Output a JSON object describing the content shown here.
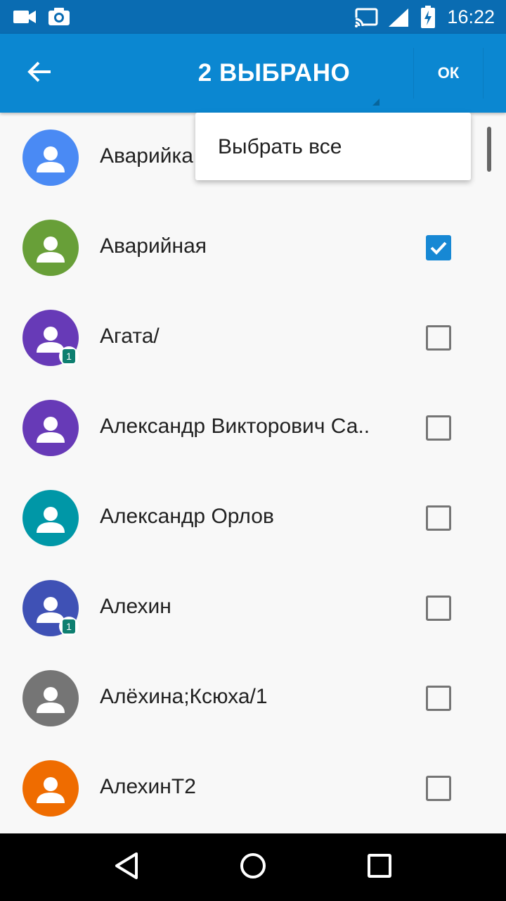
{
  "status_bar": {
    "time": "16:22",
    "left_icons": [
      "video-camera-icon",
      "camera-icon"
    ],
    "right_icons": [
      "cast-icon",
      "signal-icon",
      "battery-charging-icon"
    ]
  },
  "app_bar": {
    "title": "2 ВЫБРАНО",
    "ok_label": "ОК",
    "back_icon": "arrow-back-icon",
    "color": "#0b87d1"
  },
  "popup_menu": {
    "items": [
      {
        "label": "Выбрать все"
      }
    ]
  },
  "contacts": [
    {
      "name": "Аварийка",
      "avatar_color": "#4a8af4",
      "checked": true,
      "badge": ""
    },
    {
      "name": "Аварийная",
      "avatar_color": "#689f38",
      "checked": true,
      "badge": ""
    },
    {
      "name": "Агата/",
      "avatar_color": "#673ab7",
      "checked": false,
      "badge": "1"
    },
    {
      "name": "Александр Викторович Са..",
      "avatar_color": "#673ab7",
      "checked": false,
      "badge": ""
    },
    {
      "name": "Александр Орлов",
      "avatar_color": "#0097a7",
      "checked": false,
      "badge": ""
    },
    {
      "name": "Алехин",
      "avatar_color": "#3f51b5",
      "checked": false,
      "badge": "1"
    },
    {
      "name": "Алёхина;Ксюха/1",
      "avatar_color": "#757575",
      "checked": false,
      "badge": ""
    },
    {
      "name": "АлехинТ2",
      "avatar_color": "#ef6c00",
      "checked": false,
      "badge": ""
    }
  ],
  "nav_bar": {
    "buttons": [
      "back-triangle-icon",
      "home-circle-icon",
      "recents-square-icon"
    ]
  }
}
